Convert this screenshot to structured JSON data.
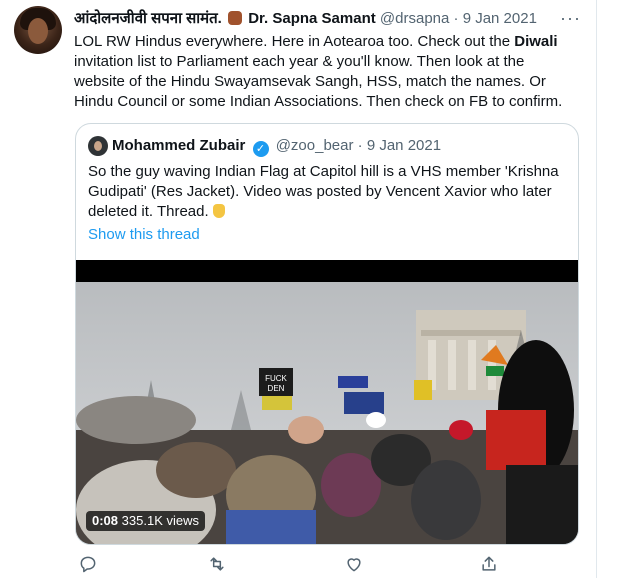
{
  "tweet": {
    "author_name": "आंदोलनजीवी सपना सामंत.",
    "author_title": "Dr. Sapna Samant",
    "handle": "@drsapna",
    "separator": "·",
    "date": "9 Jan 2021",
    "more_label": "···",
    "text_part1": "LOL RW Hindus everywhere. Here in Aotearoa too. Check out the ",
    "text_bold": "Diwali",
    "text_part2": " invitation list to Parliament each year & you'll know. Then look at the website of the Hindu Swayamsevak Sangh, HSS,  match the names. Or Hindu Council or some Indian Associations. Then check on FB to confirm."
  },
  "quoted_tweet": {
    "author_name": "Mohammed Zubair",
    "verified_mark": "✓",
    "handle": "@zoo_bear",
    "separator": "·",
    "date": "9 Jan 2021",
    "text": "So the guy waving Indian Flag at Capitol hill is a VHS member 'Krishna Gudipati' (Res Jacket). Video was posted by Vencent Xavior who later deleted it.  Thread. ",
    "show_thread": "Show this thread",
    "video": {
      "time": "0:08",
      "views": "335.1K views",
      "flag_text_top": "FUCK",
      "flag_text_bottom": "DEN"
    }
  },
  "actions": [
    "reply-icon",
    "retweet-icon",
    "like-icon",
    "share-icon"
  ],
  "colors": {
    "accent": "#1d9bf0",
    "muted": "#536471",
    "border": "#cfd9de"
  }
}
